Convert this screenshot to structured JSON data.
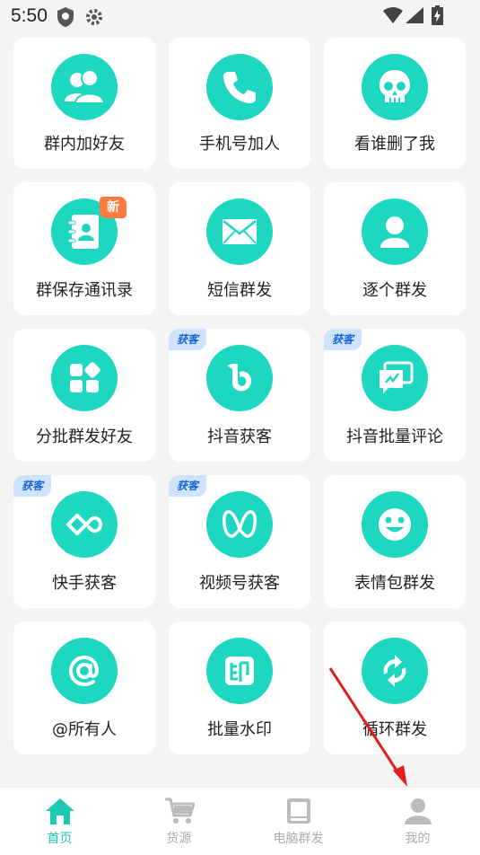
{
  "status_bar": {
    "time": "5:50"
  },
  "tiles": [
    {
      "label": "群内加好友",
      "icon": "users-icon"
    },
    {
      "label": "手机号加人",
      "icon": "phone-icon"
    },
    {
      "label": "看谁删了我",
      "icon": "skull-icon"
    },
    {
      "label": "群保存通讯录",
      "icon": "contacts-book-icon",
      "badge": "新"
    },
    {
      "label": "短信群发",
      "icon": "mail-icon"
    },
    {
      "label": "逐个群发",
      "icon": "person-icon"
    },
    {
      "label": "分批群发好友",
      "icon": "grid-icon"
    },
    {
      "label": "抖音获客",
      "icon": "douyin-icon",
      "badge": "获客"
    },
    {
      "label": "抖音批量评论",
      "icon": "comments-icon",
      "badge": "获客"
    },
    {
      "label": "快手获客",
      "icon": "kuaishou-icon",
      "badge": "获客"
    },
    {
      "label": "视频号获客",
      "icon": "channels-icon",
      "badge": "获客"
    },
    {
      "label": "表情包群发",
      "icon": "smile-icon"
    },
    {
      "label": "@所有人",
      "icon": "at-icon"
    },
    {
      "label": "批量水印",
      "icon": "watermark-icon"
    },
    {
      "label": "循环群发",
      "icon": "refresh-icon"
    }
  ],
  "tabbar": [
    {
      "label": "首页",
      "icon": "home-icon",
      "active": true
    },
    {
      "label": "货源",
      "icon": "cart-icon"
    },
    {
      "label": "电脑群发",
      "icon": "book-icon"
    },
    {
      "label": "我的",
      "icon": "profile-icon"
    }
  ],
  "colors": {
    "accent": "#1ed7c0",
    "active_tab": "#1ec9b3",
    "badge_new": "#ff7a3c",
    "badge_ke": "#cfe3ff"
  }
}
